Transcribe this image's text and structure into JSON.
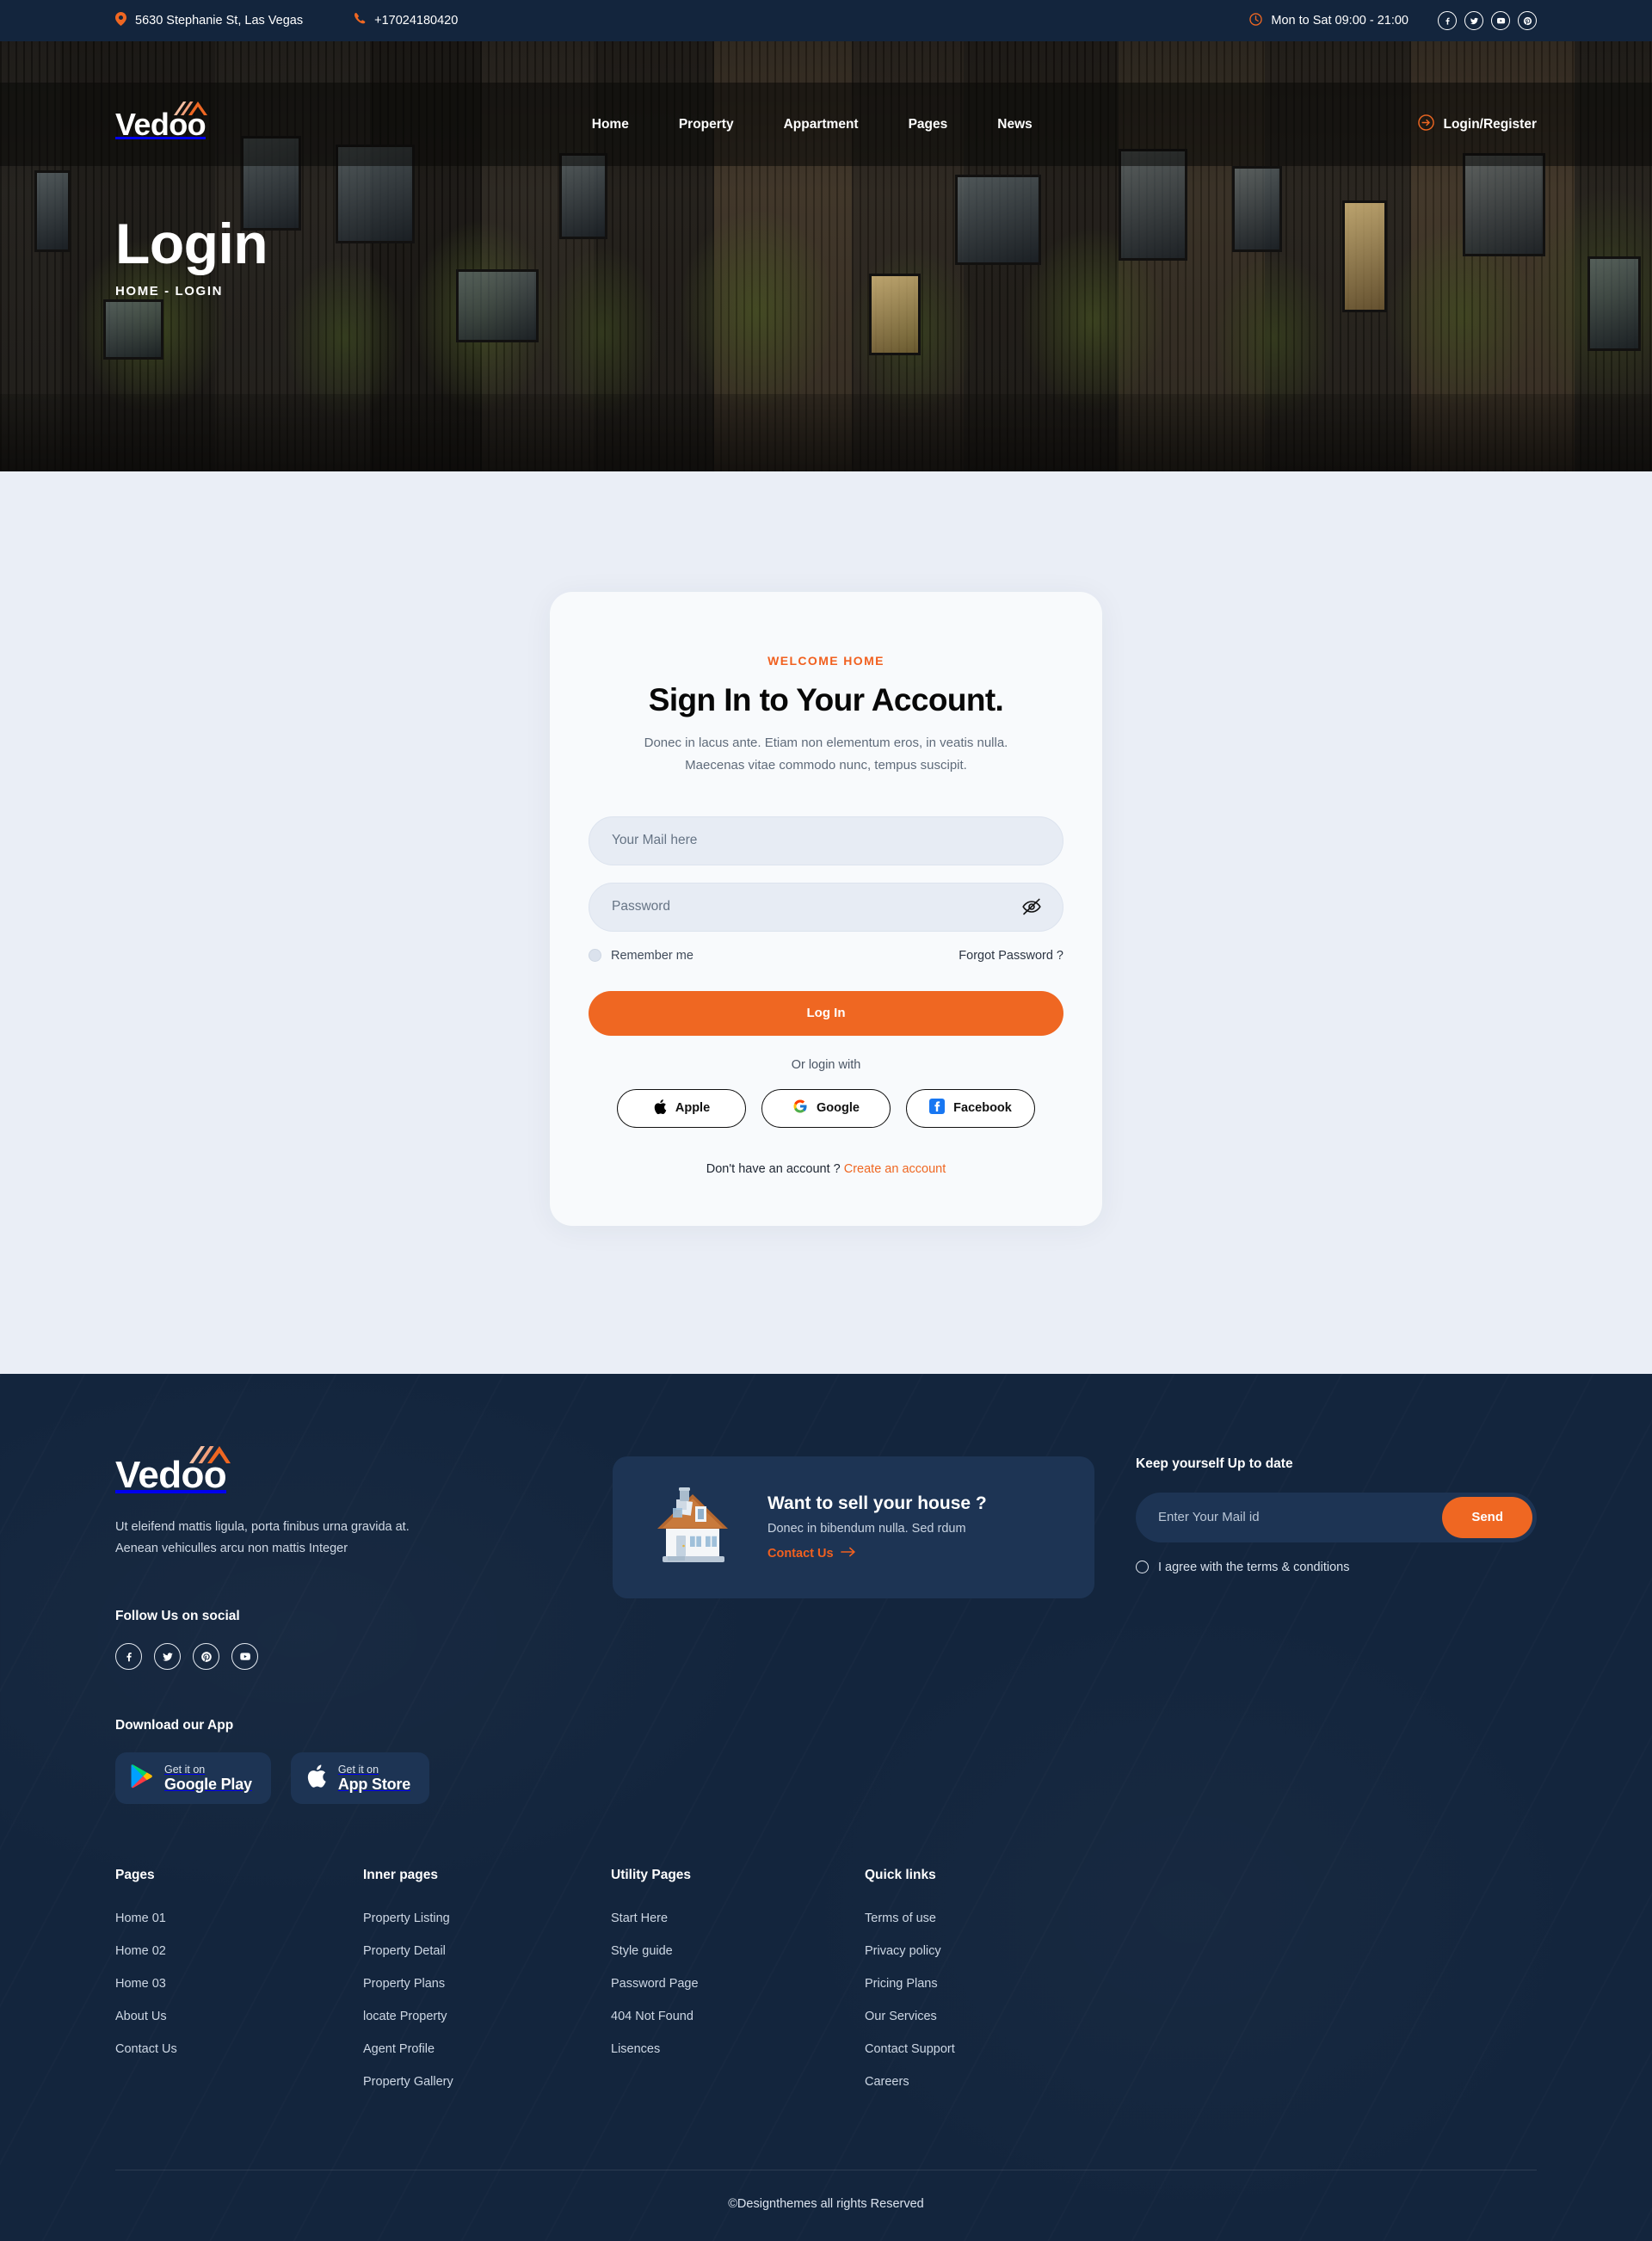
{
  "topbar": {
    "address": "5630 Stephanie St, Las Vegas",
    "phone": "+17024180420",
    "hours": "Mon to Sat  09:00 - 21:00",
    "socials": [
      "facebook-icon",
      "twitter-icon",
      "youtube-icon",
      "pinterest-icon"
    ]
  },
  "header": {
    "logo": "Vedoo",
    "nav": [
      {
        "label": "Home"
      },
      {
        "label": "Property"
      },
      {
        "label": "Appartment"
      },
      {
        "label": "Pages"
      },
      {
        "label": "News"
      }
    ],
    "login_label": "Login/Register"
  },
  "hero": {
    "title": "Login",
    "breadcrumb": "HOME - LOGIN"
  },
  "login": {
    "eyebrow": "WELCOME HOME",
    "title": "Sign In to Your Account.",
    "subtitle": "Donec in lacus ante. Etiam non elementum eros, in veatis nulla. Maecenas vitae commodo nunc, tempus suscipit.",
    "email_placeholder": "Your Mail here",
    "email_value": "",
    "password_placeholder": "Password",
    "password_value": "",
    "remember_label": "Remember me",
    "forgot_label": "Forgot Password ?",
    "submit_label": "Log In",
    "or_label": "Or login with",
    "providers": [
      {
        "label": "Apple",
        "icon": "apple-icon"
      },
      {
        "label": "Google",
        "icon": "google-icon"
      },
      {
        "label": "Facebook",
        "icon": "facebook-icon"
      }
    ],
    "no_account_text": "Don't have an account ?",
    "create_account_label": "Create an account"
  },
  "footer": {
    "logo": "Vedoo",
    "about": "Ut eleifend mattis ligula, porta finibus urna gravida at. Aenean vehiculles arcu non mattis Integer",
    "follow_head": "Follow Us on social",
    "socials": [
      "facebook-icon",
      "twitter-icon",
      "pinterest-icon",
      "youtube-icon"
    ],
    "download_head": "Download our App",
    "stores": [
      {
        "small": "Get it on",
        "big": "Google Play",
        "icon": "google-play-icon"
      },
      {
        "small": "Get it on",
        "big": "App Store",
        "icon": "apple-icon"
      }
    ],
    "promo": {
      "title": "Want to sell your house ?",
      "subtitle": "Donec in bibendum nulla. Sed rdum",
      "link_label": "Contact Us",
      "icon": "house-illustration"
    },
    "newsletter": {
      "head": "Keep yourself Up to date",
      "placeholder": "Enter Your Mail id",
      "value": "",
      "send_label": "Send",
      "agree_label": "I agree with the terms & conditions"
    },
    "columns": [
      {
        "head": "Pages",
        "links": [
          "Home 01",
          "Home 02",
          "Home 03",
          "About Us",
          "Contact Us"
        ]
      },
      {
        "head": "Inner pages",
        "links": [
          "Property Listing",
          "Property Detail",
          "Property Plans",
          "locate Property",
          "Agent Profile",
          "Property Gallery"
        ]
      },
      {
        "head": "Utility Pages",
        "links": [
          "Start Here",
          "Style guide",
          "Password Page",
          "404 Not Found",
          "Lisences"
        ]
      },
      {
        "head": "Quick links",
        "links": [
          "Terms of use",
          "Privacy policy",
          "Pricing Plans",
          "Our Services",
          "Contact Support",
          "Careers"
        ]
      }
    ],
    "copyright": "©Designthemes all rights Reserved"
  },
  "colors": {
    "accent": "#ef6722",
    "navy": "#13253d",
    "panel": "#1d3454",
    "body_bg": "#eaeef6",
    "card_bg": "#f8fafc"
  }
}
